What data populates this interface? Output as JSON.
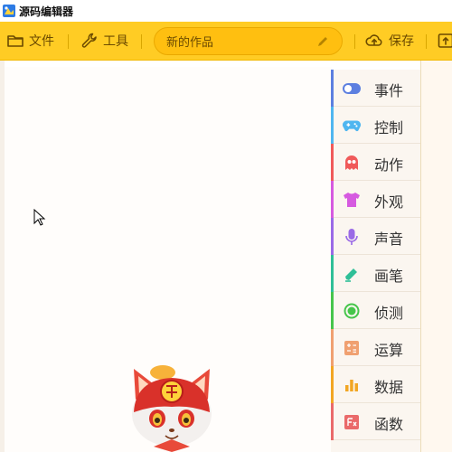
{
  "window": {
    "title": "源码编辑器"
  },
  "toolbar": {
    "file_label": "文件",
    "tools_label": "工具",
    "project_name": "新的作品",
    "save_label": "保存"
  },
  "palette": {
    "categories": [
      {
        "label": "事件",
        "icon": "toggle-icon",
        "color": "#5c7fe0"
      },
      {
        "label": "控制",
        "icon": "gamepad-icon",
        "color": "#4fb6f0"
      },
      {
        "label": "动作",
        "icon": "ghost-icon",
        "color": "#f05a5a"
      },
      {
        "label": "外观",
        "icon": "shirt-icon",
        "color": "#d65ae0"
      },
      {
        "label": "声音",
        "icon": "microphone-icon",
        "color": "#9a6ae6"
      },
      {
        "label": "画笔",
        "icon": "pen-icon",
        "color": "#2fbf97"
      },
      {
        "label": "侦测",
        "icon": "radio-target-icon",
        "color": "#46c54b"
      },
      {
        "label": "运算",
        "icon": "calculator-icon",
        "color": "#f0a070"
      },
      {
        "label": "数据",
        "icon": "bar-chart-icon",
        "color": "#f2a623"
      },
      {
        "label": "函数",
        "icon": "function-icon",
        "color": "#ea6a6a"
      }
    ]
  }
}
